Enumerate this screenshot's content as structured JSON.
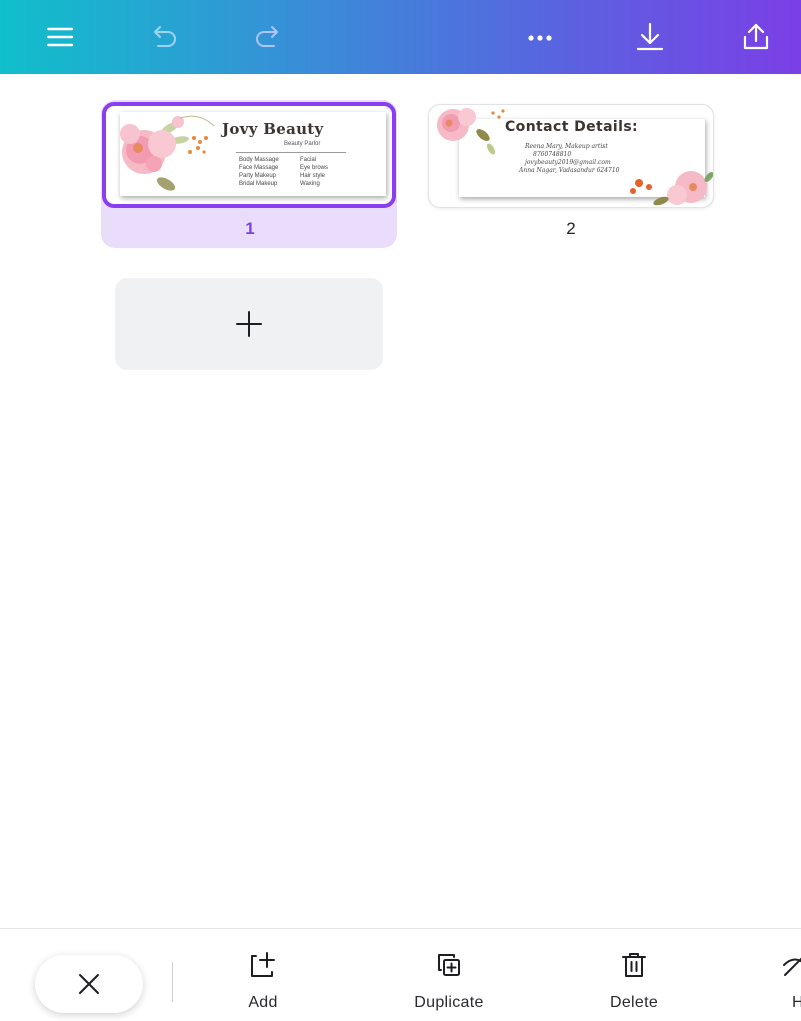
{
  "toolbar": {
    "icons": [
      "menu-icon",
      "undo-icon",
      "redo-icon",
      "more-icon",
      "download-icon",
      "share-icon"
    ],
    "gradient": [
      "#10bfcb",
      "#7b3fe6"
    ]
  },
  "pages": [
    {
      "number": "1",
      "selected": true,
      "card": {
        "title": "Jovy Beauty",
        "subtitle": "Beauty Parlor",
        "services_left": [
          "Body Massage",
          "Face Massage",
          "Party Makeup",
          "Bridal Makeup"
        ],
        "services_right": [
          "Facial",
          "Eye brows",
          "Hair style",
          "Waxing"
        ]
      }
    },
    {
      "number": "2",
      "selected": false,
      "card": {
        "title": "Contact Details:",
        "lines": [
          "Reena Mary, Makeup artist",
          "8760748810",
          "jovybeauty2019@gmail.com",
          "Anna Nagar, Vadasandur 624710"
        ]
      }
    }
  ],
  "add_page_icon": "plus-icon",
  "bottom": {
    "add": "Add",
    "duplicate": "Duplicate",
    "delete": "Delete",
    "hide": "H"
  },
  "accent": "#8b3df0"
}
